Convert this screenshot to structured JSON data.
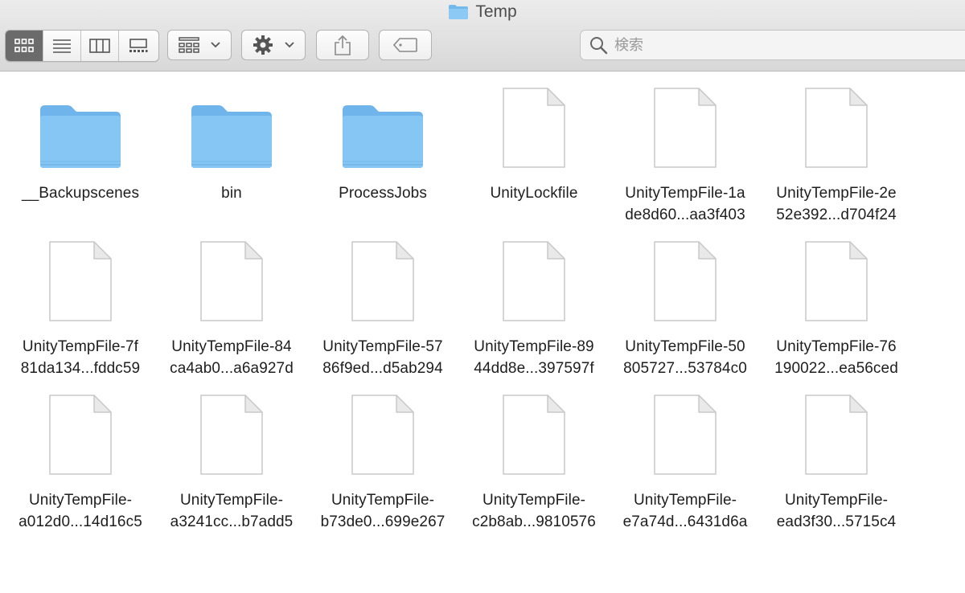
{
  "window": {
    "title": "Temp"
  },
  "toolbar": {
    "search_placeholder": "検索"
  },
  "items": [
    {
      "kind": "folder",
      "line1": "__Backupscenes",
      "line2": ""
    },
    {
      "kind": "folder",
      "line1": "bin",
      "line2": ""
    },
    {
      "kind": "folder",
      "line1": "ProcessJobs",
      "line2": ""
    },
    {
      "kind": "file",
      "line1": "UnityLockfile",
      "line2": ""
    },
    {
      "kind": "file",
      "line1": "UnityTempFile-1a",
      "line2": "de8d60...aa3f403"
    },
    {
      "kind": "file",
      "line1": "UnityTempFile-2e",
      "line2": "52e392...d704f24"
    },
    {
      "kind": "file",
      "line1": "UnityTempFile-7f",
      "line2": "81da134...fddc59"
    },
    {
      "kind": "file",
      "line1": "UnityTempFile-84",
      "line2": "ca4ab0...a6a927d"
    },
    {
      "kind": "file",
      "line1": "UnityTempFile-57",
      "line2": "86f9ed...d5ab294"
    },
    {
      "kind": "file",
      "line1": "UnityTempFile-89",
      "line2": "44dd8e...397597f"
    },
    {
      "kind": "file",
      "line1": "UnityTempFile-50",
      "line2": "805727...53784c0"
    },
    {
      "kind": "file",
      "line1": "UnityTempFile-76",
      "line2": "190022...ea56ced"
    },
    {
      "kind": "file",
      "line1": "UnityTempFile-",
      "line2": "a012d0...14d16c5"
    },
    {
      "kind": "file",
      "line1": "UnityTempFile-",
      "line2": "a3241cc...b7add5"
    },
    {
      "kind": "file",
      "line1": "UnityTempFile-",
      "line2": "b73de0...699e267"
    },
    {
      "kind": "file",
      "line1": "UnityTempFile-",
      "line2": "c2b8ab...9810576"
    },
    {
      "kind": "file",
      "line1": "UnityTempFile-",
      "line2": "e7a74d...6431d6a"
    },
    {
      "kind": "file",
      "line1": "UnityTempFile-",
      "line2": "ead3f30...5715c4"
    }
  ],
  "icons": {
    "view_icons": "icon-view-icon",
    "view_list": "list-view-icon",
    "view_columns": "column-view-icon",
    "view_gallery": "gallery-view-icon",
    "group": "group-icon",
    "action": "gear-icon",
    "share": "share-icon",
    "tags": "tag-icon",
    "search": "search-icon"
  },
  "colors": {
    "folder": "#7cc0ef",
    "active_segment": "#6b6b6b"
  }
}
